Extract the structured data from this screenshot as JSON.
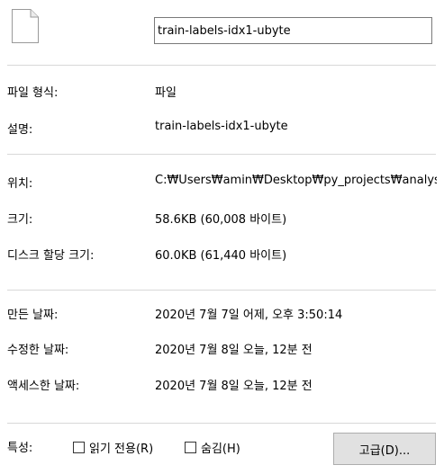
{
  "file_name": "train-labels-idx1-ubyte",
  "type": {
    "label": "파일 형식:",
    "value": "파일"
  },
  "description": {
    "label": "설명:",
    "value": "train-labels-idx1-ubyte"
  },
  "location": {
    "label": "위치:",
    "value": "C:₩Users₩amin₩Desktop₩py_projects₩analys"
  },
  "size": {
    "label": "크기:",
    "value": "58.6KB (60,008 바이트)"
  },
  "size_on_disk": {
    "label": "디스크 할당 크기:",
    "value": "60.0KB (61,440 바이트)"
  },
  "created": {
    "label": "만든 날짜:",
    "value": "2020년 7월 7일 어제, 오후 3:50:14"
  },
  "modified": {
    "label": "수정한 날짜:",
    "value": "2020년 7월 8일 오늘, 12분 전"
  },
  "accessed": {
    "label": "액세스한 날짜:",
    "value": "2020년 7월 8일 오늘, 12분 전"
  },
  "attributes": {
    "label": "특성:",
    "readonly_label": "읽기 전용(R)",
    "readonly_checked": false,
    "hidden_label": "숨김(H)",
    "hidden_checked": false,
    "advanced_button": "고급(D)..."
  },
  "icon": "blank-file-icon"
}
